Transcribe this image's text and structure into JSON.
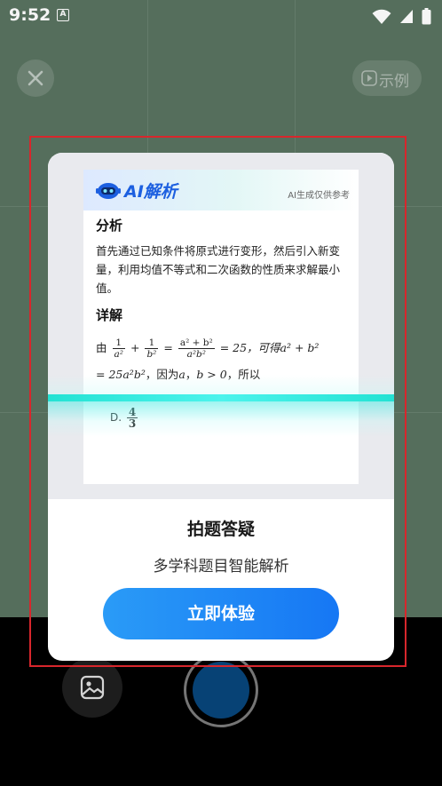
{
  "status_bar": {
    "time": "9:52",
    "app_icon_letter": "A",
    "icons": [
      "wifi-icon",
      "signal-icon",
      "battery-icon"
    ]
  },
  "camera": {
    "close_icon": "close-icon",
    "example_button_label": "示例",
    "example_icon": "play-icon"
  },
  "dialog": {
    "preview": {
      "logo_text": "AI解析",
      "logo_icon": "robot-icon",
      "ref_note": "AI生成仅供参考",
      "analysis_title": "分析",
      "analysis_text": "首先通过已知条件将原式进行变形，然后引入新变量，利用均值不等式和二次函数的性质来求解最小值。",
      "detail_title": "详解",
      "line1_prefix": "由",
      "frac1_num": "1",
      "frac1_den": "a²",
      "plus": "+",
      "frac2_num": "1",
      "frac2_den": "b²",
      "equals": "=",
      "frac3_num": "a² + b²",
      "frac3_den": "a²b²",
      "line1_suffix": "= 25，可得",
      "line1_math": "a² + b²",
      "line2_math": "= 25a²b²",
      "line2_text": "，因为",
      "line2_cond1": "a",
      "line2_sep": "，",
      "line2_cond2": "b > 0",
      "line2_suffix": "，所以",
      "option_label": "D.",
      "option_num": "4",
      "option_den": "3"
    },
    "title": "拍题答疑",
    "subtitle": "多学科题目智能解析",
    "cta_label": "立即体验"
  },
  "bottom": {
    "gallery_icon": "image-icon",
    "shutter": "shutter-button"
  },
  "colors": {
    "camera_bg": "#597360",
    "highlight_frame": "#d8262c",
    "cta": "#1677f4",
    "scan_line": "#23e2d3",
    "shutter": "#08457a"
  }
}
